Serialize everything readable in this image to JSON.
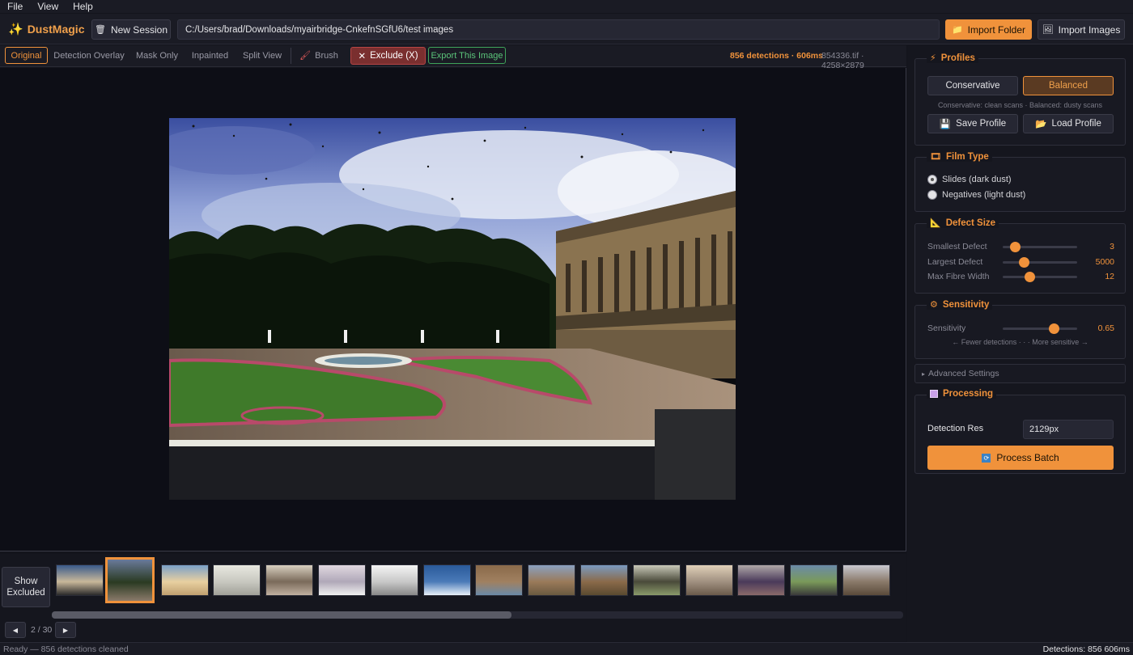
{
  "menu": [
    "File",
    "View",
    "Help"
  ],
  "app": {
    "name": "DustMagic"
  },
  "toolbar": {
    "new_session": "New Session",
    "path": "C:/Users/brad/Downloads/myairbridge-CnkefnSGfU6/test images",
    "import_folder": "Import Folder",
    "import_images": "Import Images"
  },
  "view_tabs": [
    "Original",
    "Detection Overlay",
    "Mask Only",
    "Inpainted",
    "Split View"
  ],
  "active_view": "Original",
  "brush": "Brush",
  "exclude": "Exclude (X)",
  "export": "Export This Image",
  "image_info": {
    "detections": "856 detections · 606ms",
    "file": "854336.tif · 4258×2879"
  },
  "filmstrip": {
    "show_excluded": [
      "Show",
      "Excluded"
    ],
    "selected_index": 1,
    "thumb_count": 16
  },
  "pager": {
    "prev": "◀",
    "next": "▶",
    "count": "2 / 30"
  },
  "status": {
    "left": "Ready — 856 detections cleaned",
    "right": "Detections: 856  606ms"
  },
  "panel": {
    "profiles": {
      "title": "Profiles",
      "conservative": "Conservative",
      "balanced": "Balanced",
      "active": "Balanced",
      "hint": "Conservative: clean scans · Balanced: dusty scans",
      "save": "Save Profile",
      "load": "Load Profile"
    },
    "film_type": {
      "title": "Film Type",
      "slides": "Slides (dark dust)",
      "negatives": "Negatives (light dust)",
      "selected": "slides"
    },
    "defect_size": {
      "title": "Defect Size",
      "sliders": [
        {
          "label": "Smallest Defect",
          "value": "3",
          "position": 0.16
        },
        {
          "label": "Largest Defect",
          "value": "5000",
          "position": 0.28
        },
        {
          "label": "Max Fibre Width",
          "value": "12",
          "position": 0.36
        }
      ]
    },
    "sensitivity": {
      "title": "Sensitivity",
      "label": "Sensitivity",
      "value": "0.65",
      "position": 0.68,
      "hint": "← Fewer detections · · · More sensitive →"
    },
    "advanced": "Advanced Settings",
    "processing": {
      "title": "Processing",
      "detection_res_label": "Detection Res",
      "detection_res": "2129px",
      "process": "Process Batch"
    }
  },
  "colors": {
    "accent": "#f0923b",
    "exclude": "#7a2f2f",
    "export": "#3fa35a",
    "bg": "#13141c"
  }
}
